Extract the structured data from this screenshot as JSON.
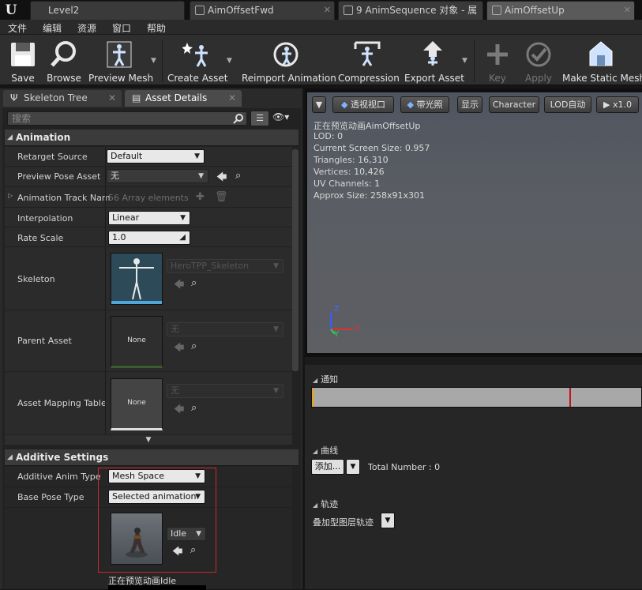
{
  "tabs": [
    {
      "label": "Level2"
    },
    {
      "label": "AimOffsetFwd"
    },
    {
      "label": "9 AnimSequence 对象 - 属"
    },
    {
      "label": "AimOffsetUp"
    }
  ],
  "menu": [
    "文件",
    "编辑",
    "资源",
    "窗口",
    "帮助"
  ],
  "toolbar": {
    "save": "Save",
    "browse": "Browse",
    "preview_mesh": "Preview Mesh",
    "create_asset": "Create Asset",
    "reimport": "Reimport Animation",
    "compression": "Compression",
    "export_asset": "Export Asset",
    "key": "Key",
    "apply": "Apply",
    "make_static_mesh": "Make Static Mesh"
  },
  "panel_tabs": {
    "skeleton_tree": "Skeleton Tree",
    "asset_details": "Asset Details"
  },
  "search": {
    "placeholder": "搜索"
  },
  "animation": {
    "header": "Animation",
    "retarget_source_label": "Retarget Source",
    "retarget_source_value": "Default",
    "preview_pose_label": "Preview Pose Asset",
    "preview_pose_value": "无",
    "track_names_label": "Animation Track Nam",
    "track_names_value": "56 Array elements",
    "interpolation_label": "Interpolation",
    "interpolation_value": "Linear",
    "rate_scale_label": "Rate Scale",
    "rate_scale_value": "1.0",
    "skeleton_label": "Skeleton",
    "skeleton_value": "HeroTPP_Skeleton",
    "parent_asset_label": "Parent Asset",
    "parent_asset_value": "无",
    "parent_thumb": "None",
    "mapping_label": "Asset Mapping Table",
    "mapping_value": "无",
    "mapping_thumb": "None"
  },
  "additive": {
    "header": "Additive Settings",
    "type_label": "Additive Anim Type",
    "type_value": "Mesh Space",
    "base_pose_label": "Base Pose Type",
    "base_pose_value": "Selected animation",
    "base_anim_value": "Idle",
    "preview_text": "正在预览动画Idle"
  },
  "viewport": {
    "perspective": "透视视口",
    "lit": "带光照",
    "show": "显示",
    "character": "Character",
    "lod": "LOD自动",
    "speed": "x1.0",
    "info": [
      "正在预览动画AimOffsetUp",
      "LOD: 0",
      "Current Screen Size: 0.957",
      "Triangles: 16,310",
      "Vertices: 10,426",
      "UV Channels: 1",
      "Approx Size: 258x91x301"
    ],
    "axis_z": "Z",
    "axis_x": "X",
    "axis_y": "Y"
  },
  "anim_panel": {
    "notify": "通知",
    "curves": "曲线",
    "add_button": "添加...",
    "total": "Total Number : 0",
    "tracks": "轨迹",
    "additive_layer": "叠加型图层轨迹"
  },
  "colors": {
    "highlight_box": "#c8282d",
    "timeline_marker": "#c0161c",
    "accent_blue": "#3b7cd3"
  }
}
